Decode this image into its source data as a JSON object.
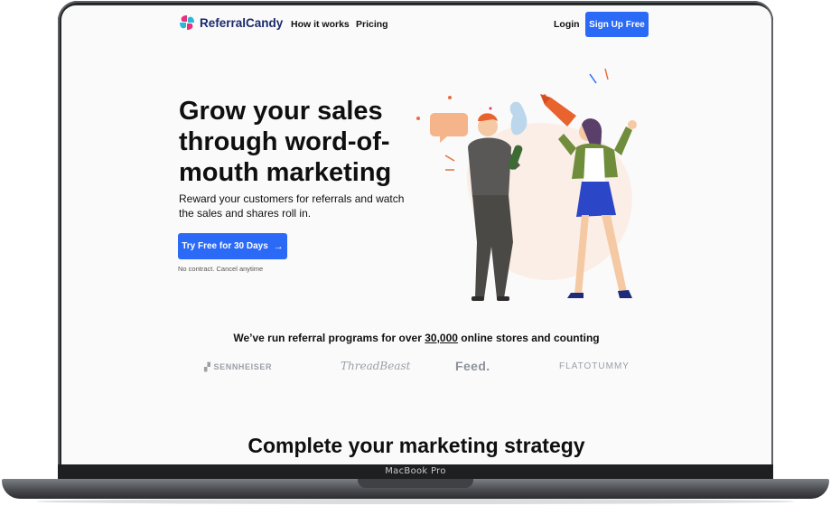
{
  "device": {
    "model_label": "MacBook Pro"
  },
  "nav": {
    "logo_text": "ReferralCandy",
    "links": [
      "How it works",
      "Pricing"
    ],
    "login_label": "Login",
    "signup_label": "Sign Up Free"
  },
  "hero": {
    "headline": "Grow your sales through word-of-mouth marketing",
    "subtext": "Reward your customers for referrals and watch the sales and shares roll in.",
    "cta_label": "Try Free for 30 Days",
    "cta_icon": "arrow-right-icon",
    "note": "No contract. Cancel anytime",
    "illustration": "people-celebrating-illustration"
  },
  "social_proof": {
    "text_before": "We’ve run referral programs for over ",
    "highlight": "30,000",
    "text_after": " online stores and counting",
    "brands": [
      "SENNHEISER",
      "ThreadBeast",
      "Feed.",
      "FLATOTUMMY"
    ]
  },
  "next_section": {
    "title": "Complete your marketing strategy"
  },
  "colors": {
    "accent": "#2a6af7",
    "brand_navy": "#1a2a6c",
    "brand_pink": "#e8317d",
    "brand_cyan": "#27b9d8"
  }
}
